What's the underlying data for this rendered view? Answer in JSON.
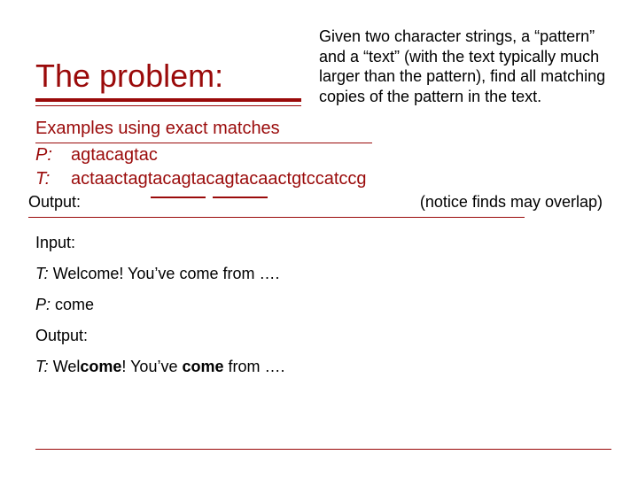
{
  "title": "The problem:",
  "description": "Given two character strings, a “pattern” and a “text” (with the text typically much larger than the pattern), find all matching copies of the pattern in the text.",
  "examples_heading": "Examples using exact matches",
  "example1": {
    "p_label": "P:",
    "p_value": "agtacagtac",
    "t_label": "T:",
    "t_value": "actaactagtacagtacagtacaactgtccatccg"
  },
  "output_label": "Output:",
  "notice": "(notice finds may overlap)",
  "input_label": "Input:",
  "input_t_label": "T:",
  "input_t_value": "Welcome! You’ve come from ….",
  "input_p_label": "P:",
  "input_p_value": "come",
  "output2_label": "Output:",
  "output2_t_label": "T:",
  "output2_prefix": "Wel",
  "output2_bold1": "come",
  "output2_mid": "! You’ve ",
  "output2_bold2": "come",
  "output2_suffix": " from …."
}
